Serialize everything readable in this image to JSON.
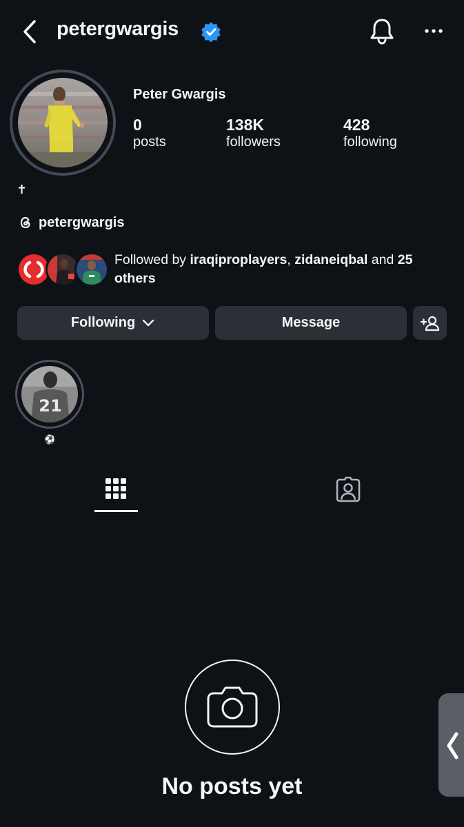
{
  "header": {
    "username": "petergwargis"
  },
  "profile": {
    "full_name": "Peter Gwargis",
    "stats": [
      {
        "value": "0",
        "label": "posts"
      },
      {
        "value": "138K",
        "label": "followers"
      },
      {
        "value": "428",
        "label": "following"
      }
    ],
    "bio_symbol": "✝"
  },
  "threads": {
    "handle": "petergwargis"
  },
  "followed_by": {
    "prefix": "Followed by ",
    "user1": "iraqiproplayers",
    "separator": ", ",
    "user2": "zidaneiqbal",
    "conjunction": " and ",
    "others": "25 others"
  },
  "actions": {
    "following_label": "Following",
    "message_label": "Message"
  },
  "highlights": [
    {
      "label": "⚽",
      "jersey_number": "21"
    }
  ],
  "empty_state": {
    "title": "No posts yet"
  },
  "colors": {
    "background": "#0e1217",
    "button": "#2b2f36",
    "verified": "#2c95f5"
  },
  "icons": {
    "back": "chevron-left-icon",
    "verified": "verified-badge-icon",
    "bell": "bell-icon",
    "more": "more-icon",
    "threads": "threads-icon",
    "add_person": "add-person-icon",
    "grid": "grid-icon",
    "tagged": "tagged-icon",
    "camera": "camera-icon"
  }
}
